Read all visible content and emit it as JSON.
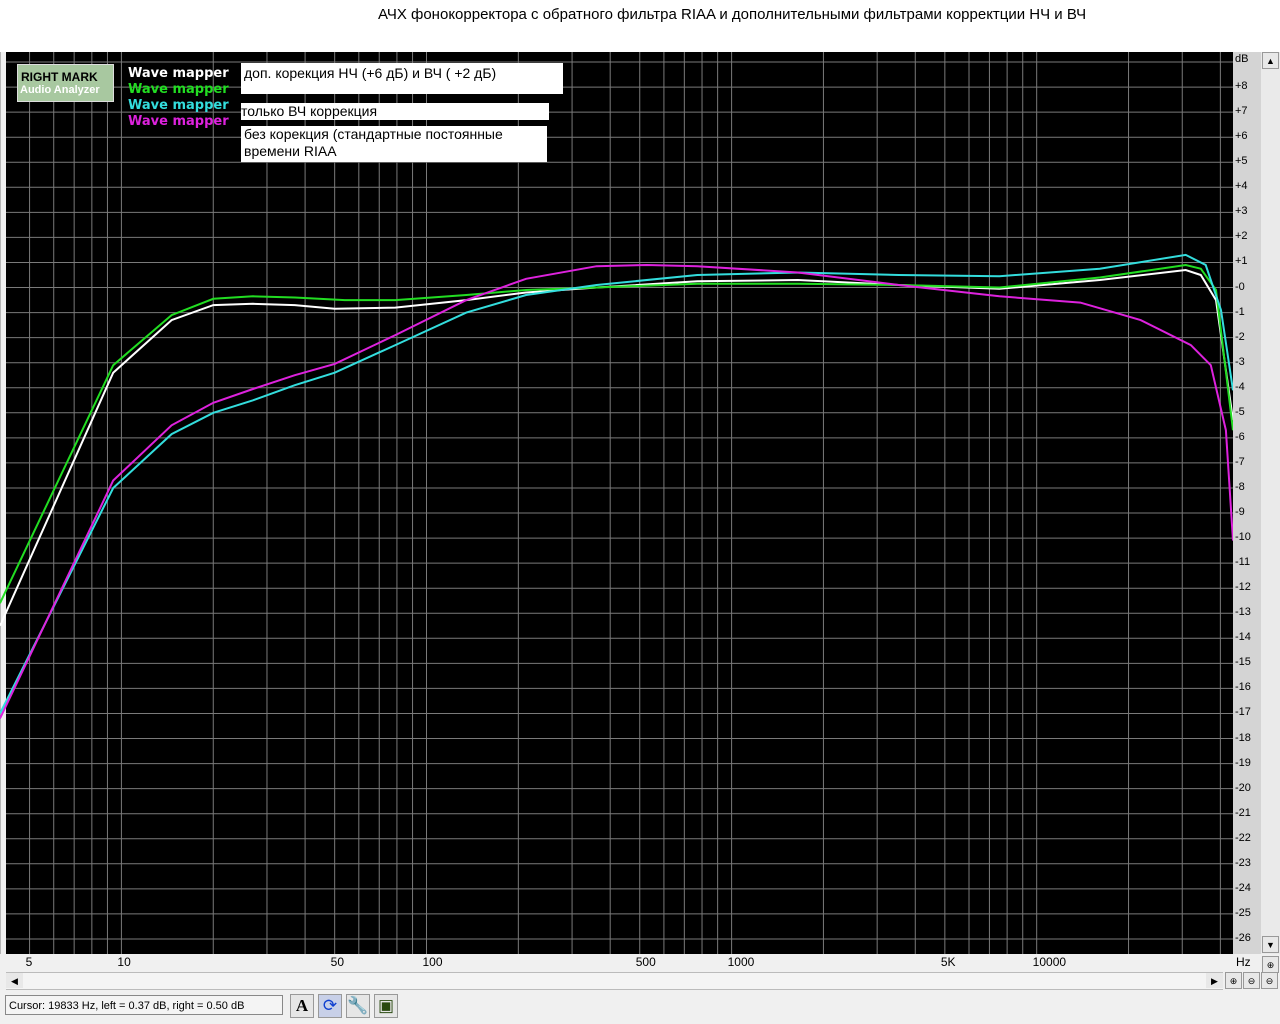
{
  "window": {
    "title": "АЧХ фонокорректора с обратного фильтра RIAA и дополнительными фильтрами корректции НЧ и ВЧ"
  },
  "logo": {
    "line1": "RIGHT MARK",
    "line2": "Audio Analyzer"
  },
  "legend": [
    {
      "label": "Wave mapper",
      "color": "#ffffff"
    },
    {
      "label": "Wave mapper",
      "color": "#22dd22"
    },
    {
      "label": "Wave mapper",
      "color": "#33dddd"
    },
    {
      "label": "Wave mapper",
      "color": "#dd22dd"
    }
  ],
  "annotations": [
    "доп. корекция НЧ (+6 дБ) и  ВЧ ( +2 дБ)",
    "только ВЧ коррекция",
    "без корекция (стандартные  постоянные времени RIAA"
  ],
  "status": {
    "cursor": "Cursor:  19833 Hz,  left = 0.37 dB,  right = 0.50 dB"
  },
  "toolbar": {
    "icons": [
      "font-icon",
      "refresh-icon",
      "wrench-icon",
      "save-icon"
    ]
  },
  "chart_data": {
    "type": "line",
    "title": "АЧХ фонокорректора с обратного фильтра RIAA и дополнительными фильтрами корректции НЧ и ВЧ",
    "xlabel": "Hz",
    "ylabel": "dB",
    "xscale": "log",
    "xlim": [
      4,
      44000
    ],
    "ylim": [
      -26.6,
      9.4
    ],
    "grid": true,
    "background": "#000000",
    "x_ticks": [
      "5",
      "10",
      "50",
      "100",
      "500",
      "1000",
      "5K",
      "10000"
    ],
    "x_tick_values": [
      5,
      10,
      50,
      100,
      500,
      1000,
      5000,
      10000
    ],
    "y_ticks": [
      "+8",
      "+7",
      "+6",
      "+5",
      "+4",
      "+3",
      "+2",
      "+1",
      "-0",
      "-1",
      "-2",
      "-3",
      "-4",
      "-5",
      "-6",
      "-7",
      "-8",
      "-9",
      "-10",
      "-11",
      "-12",
      "-13",
      "-14",
      "-15",
      "-16",
      "-17",
      "-18",
      "-19",
      "-20",
      "-21",
      "-22",
      "-23",
      "-24",
      "-25",
      "-26"
    ],
    "legend_position": "top-left",
    "series": [
      {
        "name": "Wave mapper",
        "color": "#ffffff",
        "x": [
          4,
          9.4,
          14.6,
          20,
          27,
          37,
          50,
          79,
          135,
          212,
          361,
          772,
          1650,
          3530,
          7550,
          16100,
          30800,
          34500,
          38700,
          44000
        ],
        "y": [
          -13.5,
          -3.4,
          -1.3,
          -0.7,
          -0.65,
          -0.7,
          -0.85,
          -0.8,
          -0.5,
          -0.2,
          0,
          0.25,
          0.3,
          0.1,
          -0.05,
          0.3,
          0.7,
          0.5,
          -0.5,
          -5.3
        ]
      },
      {
        "name": "Wave mapper",
        "color": "#22dd22",
        "x": [
          4,
          9.4,
          14.6,
          20,
          27,
          37,
          54,
          79,
          135,
          212,
          361,
          772,
          1650,
          3530,
          7550,
          16100,
          30800,
          34500,
          38700,
          44000
        ],
        "y": [
          -12.6,
          -3.1,
          -1.1,
          -0.45,
          -0.35,
          -0.4,
          -0.5,
          -0.5,
          -0.3,
          -0.1,
          0,
          0.15,
          0.15,
          0.1,
          0,
          0.4,
          0.9,
          0.75,
          -0.1,
          -5.7
        ]
      },
      {
        "name": "Wave mapper",
        "color": "#33dddd",
        "x": [
          4,
          9.4,
          14.6,
          20,
          27,
          37,
          50,
          79,
          135,
          212,
          361,
          772,
          1650,
          3530,
          7550,
          16100,
          30800,
          35800,
          40200,
          44000
        ],
        "y": [
          -17,
          -8,
          -5.85,
          -5.0,
          -4.5,
          -3.9,
          -3.4,
          -2.3,
          -1.0,
          -0.3,
          0.1,
          0.5,
          0.6,
          0.5,
          0.45,
          0.75,
          1.3,
          0.9,
          -0.9,
          -4.1
        ]
      },
      {
        "name": "Wave mapper",
        "color": "#dd22dd",
        "x": [
          4,
          9.4,
          14.6,
          20,
          27,
          37,
          50,
          79,
          135,
          212,
          361,
          528,
          772,
          1650,
          3530,
          7550,
          13900,
          21900,
          32000,
          37200,
          41700,
          44000
        ],
        "y": [
          -17.2,
          -7.7,
          -5.5,
          -4.6,
          -4.05,
          -3.5,
          -3.05,
          -1.9,
          -0.5,
          0.35,
          0.85,
          0.9,
          0.85,
          0.6,
          0.1,
          -0.35,
          -0.6,
          -1.3,
          -2.3,
          -3.1,
          -5.7,
          -10.1
        ]
      }
    ]
  }
}
